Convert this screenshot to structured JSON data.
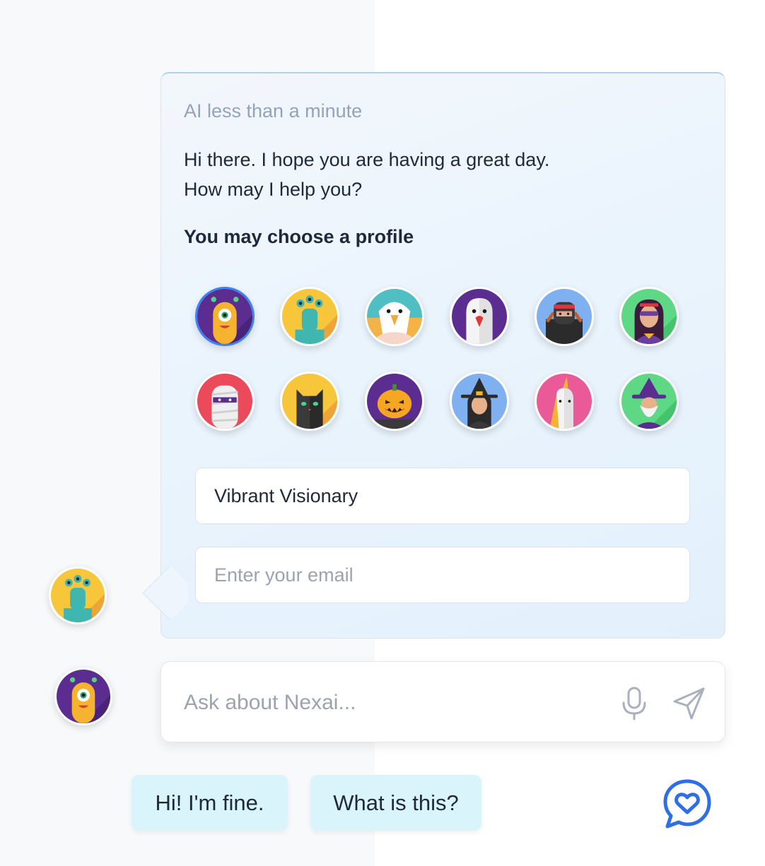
{
  "message": {
    "meta": "AI less than a minute",
    "line1": "Hi there. I hope you are having a great day.",
    "line2": "How may I help you?",
    "choose_label": "You may choose a profile"
  },
  "profile": {
    "avatars": [
      {
        "name": "yellow-cyclops-monster",
        "selected": true
      },
      {
        "name": "teal-three-eyed-alien"
      },
      {
        "name": "eagle"
      },
      {
        "name": "ghost"
      },
      {
        "name": "ninja"
      },
      {
        "name": "masked-heroine"
      },
      {
        "name": "mummy"
      },
      {
        "name": "black-cat"
      },
      {
        "name": "jack-o-lantern"
      },
      {
        "name": "witch"
      },
      {
        "name": "unicorn"
      },
      {
        "name": "wizard"
      }
    ],
    "name_value": "Vibrant Visionary",
    "email_placeholder": "Enter your email"
  },
  "composer": {
    "placeholder": "Ask about Nexai...",
    "mic_icon": "microphone-icon",
    "send_icon": "send-icon"
  },
  "suggestions": [
    "Hi! I'm fine.",
    "What is this?"
  ],
  "colors": {
    "accent": "#3b82f6",
    "chip_bg": "#d9f4fb",
    "card_bg": "#eaf4fd"
  }
}
